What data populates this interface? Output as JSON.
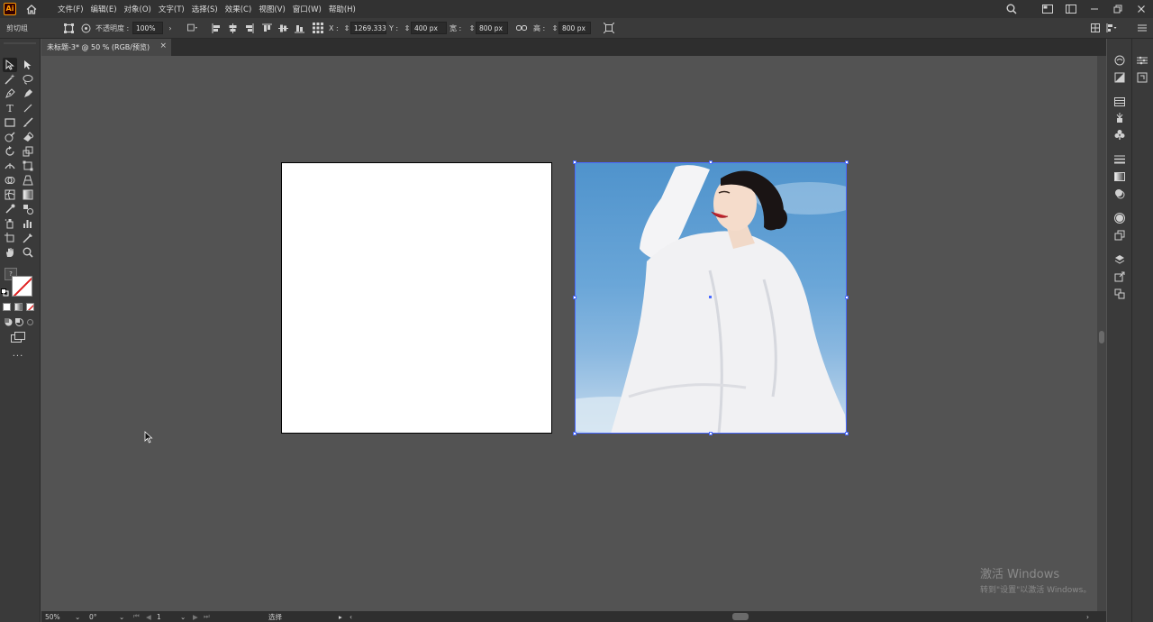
{
  "app": {
    "logo_text": "Ai"
  },
  "menu": {
    "items": [
      "文件(F)",
      "编辑(E)",
      "对象(O)",
      "文字(T)",
      "选择(S)",
      "效果(C)",
      "视图(V)",
      "窗口(W)",
      "帮助(H)"
    ]
  },
  "control_bar": {
    "clip_group_label": "剪切组",
    "opacity_label": "不透明度 :",
    "opacity_value": "100%",
    "x_label": "X :",
    "x_value": "1269.333",
    "y_label": "Y :",
    "y_value": "400 px",
    "w_label": "宽 :",
    "w_value": "800 px",
    "h_label": "高 :",
    "h_value": "800 px"
  },
  "document_tab": {
    "title": "未标题-3* @ 50 % (RGB/预览)",
    "close_glyph": "×"
  },
  "status_bar": {
    "zoom": "50%",
    "rotation": "0°",
    "artboard_index": "1",
    "tool_name": "选择"
  },
  "watermark": {
    "line1": "激活 Windows",
    "line2": "转到\"设置\"以激活 Windows。"
  },
  "colors": {
    "menubar_bg": "#323232",
    "panel_bg": "#3a3a3a",
    "canvas_bg": "#535353",
    "selection": "#4a6aff",
    "ai_orange": "#ff9a00"
  }
}
